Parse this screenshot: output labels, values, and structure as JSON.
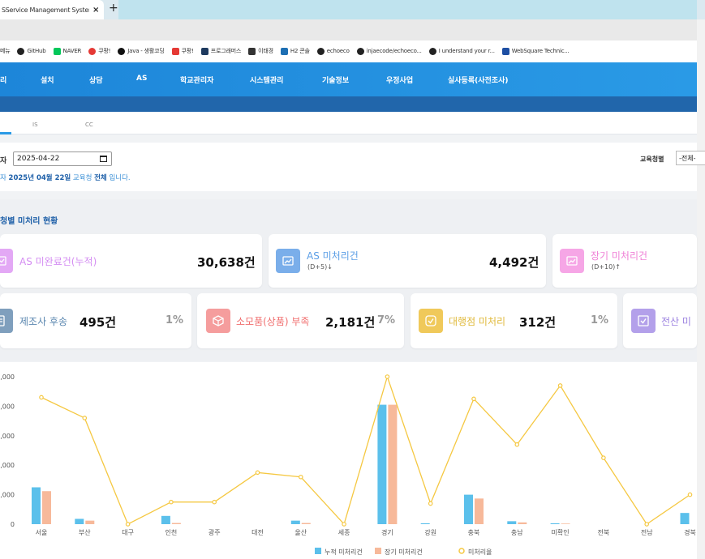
{
  "browser": {
    "tab_title": "SService Management System",
    "tab_close": "×",
    "new_tab": "+",
    "bookmarks": [
      {
        "label": "메뉴",
        "color": "#999999"
      },
      {
        "label": "GitHub",
        "color": "#222222"
      },
      {
        "label": "NAVER",
        "color": "#03c75a"
      },
      {
        "label": "쿠팡!",
        "color": "#e53935"
      },
      {
        "label": "Java - 생활코딩",
        "color": "#111111"
      },
      {
        "label": "쿠팡!",
        "color": "#e53935"
      },
      {
        "label": "프로그래머스",
        "color": "#1e3a5f"
      },
      {
        "label": "이태경",
        "color": "#333333"
      },
      {
        "label": "H2 콘솔",
        "color": "#1e6fb3"
      },
      {
        "label": "echoeco",
        "color": "#222222"
      },
      {
        "label": "injaecode/echoeco...",
        "color": "#222222"
      },
      {
        "label": "I understand your r...",
        "color": "#222222"
      },
      {
        "label": "WebSquare Technic...",
        "color": "#1e4fa3"
      }
    ]
  },
  "nav": {
    "items": [
      "리",
      "설치",
      "상담",
      "AS",
      "학교관리자",
      "시스템관리",
      "기술정보",
      "우정사업",
      "실사등록(사전조사)"
    ]
  },
  "subtabs": [
    "IS",
    "CC"
  ],
  "filter": {
    "date_label": "자",
    "date_value": "2025-04-22",
    "info_prefix": "자 ",
    "info_date": "2025년 04월 22일",
    "info_mid": " 교육청 ",
    "info_scope": "전체",
    "info_suffix": " 입니다.",
    "edu_label": "교육청별",
    "edu_value": "-전체-"
  },
  "section": {
    "title": "청별 미처리 현황"
  },
  "cards_row1": [
    {
      "label": "AS 미완료건(누적)",
      "sub": "",
      "value": "30,638건",
      "color": "#d48df2",
      "icon_bg": "#e3a8f5"
    },
    {
      "label": "AS 미처리건",
      "sub": "(D+5)↓",
      "value": "4,492건",
      "color": "#5b9ee6",
      "icon_bg": "#7aaeea"
    },
    {
      "label": "장기 미처리건",
      "sub": "(D+10)↑",
      "value": "",
      "color": "#ef7fd6",
      "icon_bg": "#f6a6e6"
    }
  ],
  "cards_row2": [
    {
      "label": "제조사 후송",
      "value": "495건",
      "pct": "1%",
      "color": "#5b87b0",
      "icon_bg": "#7f9fbd"
    },
    {
      "label": "소모품(상품) 부족",
      "value": "2,181건",
      "pct": "7%",
      "color": "#f06d6d",
      "icon_bg": "#f59d9d"
    },
    {
      "label": "대행점 미처리",
      "value": "312건",
      "pct": "1%",
      "color": "#e0b93a",
      "icon_bg": "#f0c95a"
    },
    {
      "label": "전산 미",
      "value": "",
      "pct": "",
      "color": "#9c82e0",
      "icon_bg": "#b3a0ea"
    }
  ],
  "chart_data": {
    "type": "bar",
    "categories": [
      "서울",
      "부산",
      "대구",
      "인천",
      "광주",
      "대전",
      "울산",
      "세종",
      "경기",
      "강원",
      "충북",
      "충남",
      "미확인",
      "전북",
      "전남",
      "경북"
    ],
    "ytick_labels": [
      "0",
      ",000",
      ",000",
      ",000",
      ",000",
      ",000"
    ],
    "y_unit": 1000,
    "ylim": [
      0,
      5000
    ],
    "series": [
      {
        "name": "누적 미처리건",
        "kind": "bar",
        "color": "#5bc0eb",
        "values": [
          1250,
          180,
          0,
          280,
          0,
          0,
          120,
          0,
          4050,
          30,
          1000,
          100,
          30,
          0,
          0,
          380
        ]
      },
      {
        "name": "장기 미처리건",
        "kind": "bar",
        "color": "#f7b99a",
        "values": [
          1120,
          120,
          0,
          40,
          0,
          0,
          40,
          0,
          4050,
          0,
          870,
          60,
          20,
          0,
          0,
          0
        ]
      },
      {
        "name": "미처리율",
        "kind": "line",
        "color": "#f5c842",
        "values": [
          4.3,
          3.6,
          0,
          0.75,
          0.75,
          1.75,
          1.6,
          0,
          5.0,
          0.7,
          4.25,
          2.7,
          4.7,
          2.25,
          0,
          1.0
        ]
      }
    ],
    "legend": [
      "누적 미처리건",
      "장기 미처리건",
      "미처리율"
    ],
    "legend_position": "bottom",
    "grid": false
  }
}
